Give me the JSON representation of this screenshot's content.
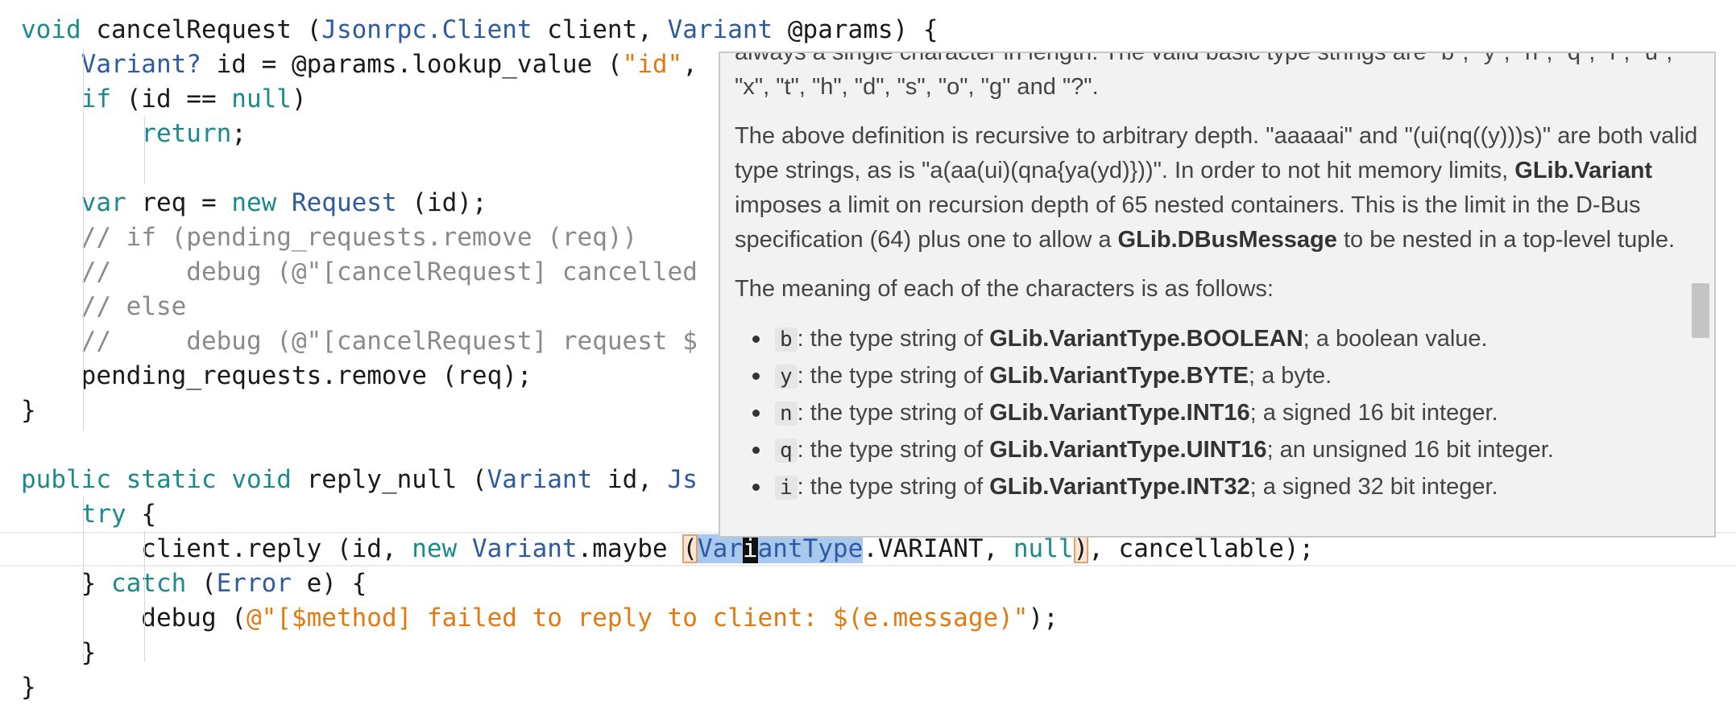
{
  "code_lines": [
    {
      "tokens": [
        {
          "t": "void",
          "c": "kw"
        },
        {
          "t": " cancelRequest (",
          "c": "plain"
        },
        {
          "t": "Jsonrpc.Client",
          "c": "type"
        },
        {
          "t": " client, ",
          "c": "plain"
        },
        {
          "t": "Variant",
          "c": "type"
        },
        {
          "t": " @params) {",
          "c": "plain"
        }
      ]
    },
    {
      "tokens": [
        {
          "t": "    ",
          "c": "plain"
        },
        {
          "t": "Variant?",
          "c": "type"
        },
        {
          "t": " id = @params.lookup_value (",
          "c": "plain"
        },
        {
          "t": "\"id\"",
          "c": "str"
        },
        {
          "t": ",",
          "c": "plain"
        }
      ]
    },
    {
      "tokens": [
        {
          "t": "    ",
          "c": "plain"
        },
        {
          "t": "if",
          "c": "kw"
        },
        {
          "t": " (id == ",
          "c": "plain"
        },
        {
          "t": "null",
          "c": "kw"
        },
        {
          "t": ")",
          "c": "plain"
        }
      ]
    },
    {
      "tokens": [
        {
          "t": "        ",
          "c": "plain"
        },
        {
          "t": "return",
          "c": "kw"
        },
        {
          "t": ";",
          "c": "plain"
        }
      ]
    },
    {
      "tokens": []
    },
    {
      "tokens": [
        {
          "t": "    ",
          "c": "plain"
        },
        {
          "t": "var",
          "c": "kw"
        },
        {
          "t": " req = ",
          "c": "plain"
        },
        {
          "t": "new",
          "c": "kw"
        },
        {
          "t": " ",
          "c": "plain"
        },
        {
          "t": "Request",
          "c": "type"
        },
        {
          "t": " (id);",
          "c": "plain"
        }
      ]
    },
    {
      "tokens": [
        {
          "t": "    ",
          "c": "plain"
        },
        {
          "t": "// if (pending_requests.remove (req))",
          "c": "cmt"
        }
      ]
    },
    {
      "tokens": [
        {
          "t": "    ",
          "c": "plain"
        },
        {
          "t": "//     debug (@\"[cancelRequest] cancelled",
          "c": "cmt"
        }
      ]
    },
    {
      "tokens": [
        {
          "t": "    ",
          "c": "plain"
        },
        {
          "t": "// else",
          "c": "cmt"
        }
      ]
    },
    {
      "tokens": [
        {
          "t": "    ",
          "c": "plain"
        },
        {
          "t": "//     debug (@\"[cancelRequest] request $",
          "c": "cmt"
        }
      ]
    },
    {
      "tokens": [
        {
          "t": "    pending_requests.remove (req);",
          "c": "plain"
        }
      ]
    },
    {
      "tokens": [
        {
          "t": "}",
          "c": "plain"
        }
      ]
    },
    {
      "tokens": []
    },
    {
      "tokens": [
        {
          "t": "public",
          "c": "kw"
        },
        {
          "t": " ",
          "c": "plain"
        },
        {
          "t": "static",
          "c": "kw"
        },
        {
          "t": " ",
          "c": "plain"
        },
        {
          "t": "void",
          "c": "kw"
        },
        {
          "t": " reply_null (",
          "c": "plain"
        },
        {
          "t": "Variant",
          "c": "type"
        },
        {
          "t": " id, ",
          "c": "plain"
        },
        {
          "t": "Js",
          "c": "type"
        }
      ]
    },
    {
      "tokens": [
        {
          "t": "    ",
          "c": "plain"
        },
        {
          "t": "try",
          "c": "kw"
        },
        {
          "t": " {",
          "c": "plain"
        }
      ]
    },
    {
      "current": true,
      "tokens": [
        {
          "t": "        client.reply (id, ",
          "c": "plain"
        },
        {
          "t": "new",
          "c": "kw"
        },
        {
          "t": " ",
          "c": "plain"
        },
        {
          "t": "Variant",
          "c": "type"
        },
        {
          "t": ".maybe ",
          "c": "plain"
        },
        {
          "t": "(",
          "c": "paren"
        },
        {
          "t": "Var",
          "c": "sel"
        },
        {
          "t": "i",
          "c": "caret"
        },
        {
          "t": "antType",
          "c": "sel"
        },
        {
          "t": ".VARIANT, ",
          "c": "plain"
        },
        {
          "t": "null",
          "c": "kw"
        },
        {
          "t": ")",
          "c": "paren"
        },
        {
          "t": ", cancellable);",
          "c": "plain"
        }
      ]
    },
    {
      "tokens": [
        {
          "t": "    } ",
          "c": "plain"
        },
        {
          "t": "catch",
          "c": "kw"
        },
        {
          "t": " (",
          "c": "plain"
        },
        {
          "t": "Error",
          "c": "type"
        },
        {
          "t": " e) {",
          "c": "plain"
        }
      ]
    },
    {
      "tokens": [
        {
          "t": "        debug (",
          "c": "plain"
        },
        {
          "t": "@\"[$method] failed to reply to client: $(e.message)\"",
          "c": "str"
        },
        {
          "t": ");",
          "c": "plain"
        }
      ]
    },
    {
      "tokens": [
        {
          "t": "    }",
          "c": "plain"
        }
      ]
    },
    {
      "tokens": [
        {
          "t": "}",
          "c": "plain"
        }
      ]
    }
  ],
  "doc_popup": {
    "para_cut": "always a single character in length. The valid basic type strings are \"b\", \"y\", \"n\", \"q\", \"i\", \"u\", \"x\", \"t\", \"h\", \"d\", \"s\", \"o\", \"g\" and \"?\".",
    "para_recursive_1": "The above definition is recursive to arbitrary depth. \"aaaaai\" and \"(ui(nq((y)))s)\" are both valid type strings, as is \"a(aa(ui)(qna{ya(yd)}))\". In order to not hit memory limits, ",
    "para_recursive_b1": "GLib.Variant",
    "para_recursive_2": " imposes a limit on recursion depth of 65 nested containers. This is the limit in the D-Bus specification (64) plus one to allow a ",
    "para_recursive_b2": "GLib.DBusMessage",
    "para_recursive_3": " to be nested in a top-level tuple.",
    "para_meaning": "The meaning of each of the characters is as follows:",
    "items": [
      {
        "code": "b",
        "pre": ": the type string of ",
        "bold": "GLib.VariantType.BOOLEAN",
        "post": "; a boolean value."
      },
      {
        "code": "y",
        "pre": ": the type string of ",
        "bold": "GLib.VariantType.BYTE",
        "post": "; a byte."
      },
      {
        "code": "n",
        "pre": ": the type string of ",
        "bold": "GLib.VariantType.INT16",
        "post": "; a signed 16 bit integer."
      },
      {
        "code": "q",
        "pre": ": the type string of ",
        "bold": "GLib.VariantType.UINT16",
        "post": "; an unsigned 16 bit integer."
      },
      {
        "code": "i",
        "pre": ": the type string of ",
        "bold": "GLib.VariantType.INT32",
        "post": "; a signed 32 bit integer."
      }
    ]
  },
  "colors": {
    "keyword": "#1b8a8a",
    "type": "#2e5aa0",
    "string": "#e07a10",
    "comment": "#8a8a8a",
    "selection": "#a9c8ee",
    "popup_bg": "#f2f2f2"
  }
}
